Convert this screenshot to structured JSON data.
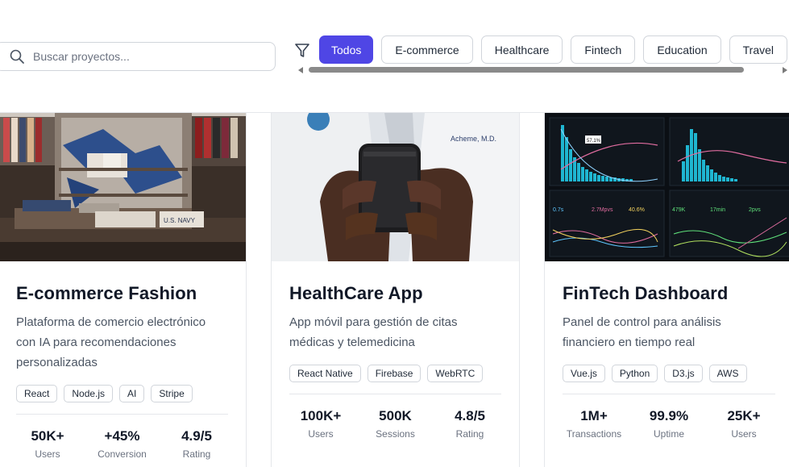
{
  "search": {
    "placeholder": "Buscar proyectos..."
  },
  "filters": [
    "Todos",
    "E-commerce",
    "Healthcare",
    "Fintech",
    "Education",
    "Travel"
  ],
  "accent": "#4f46e5",
  "cards": [
    {
      "title": "E-commerce Fashion",
      "description": "Plataforma de comercio electrónico con IA para recomendaciones personalizadas",
      "tags": [
        "React",
        "Node.js",
        "AI",
        "Stripe"
      ],
      "stats": [
        {
          "value": "50K+",
          "label": "Users"
        },
        {
          "value": "+45%",
          "label": "Conversion"
        },
        {
          "value": "4.9/5",
          "label": "Rating"
        }
      ],
      "image_text": "U.S. NAVY"
    },
    {
      "title": "HealthCare App",
      "description": "App móvil para gestión de citas médicas y telemedicina",
      "tags": [
        "React Native",
        "Firebase",
        "WebRTC"
      ],
      "stats": [
        {
          "value": "100K+",
          "label": "Users"
        },
        {
          "value": "500K",
          "label": "Sessions"
        },
        {
          "value": "4.8/5",
          "label": "Rating"
        }
      ],
      "image_text": "Acheme, M.D."
    },
    {
      "title": "FinTech Dashboard",
      "description": "Panel de control para análisis financiero en tiempo real",
      "tags": [
        "Vue.js",
        "Python",
        "D3.js",
        "AWS"
      ],
      "stats": [
        {
          "value": "1M+",
          "label": "Transactions"
        },
        {
          "value": "99.9%",
          "label": "Uptime"
        },
        {
          "value": "25K+",
          "label": "Users"
        }
      ],
      "image_text": [
        "57.1%",
        "0.7s",
        "2.7Mpvs",
        "40.6%",
        "479K",
        "17min",
        "2pvs"
      ]
    }
  ]
}
